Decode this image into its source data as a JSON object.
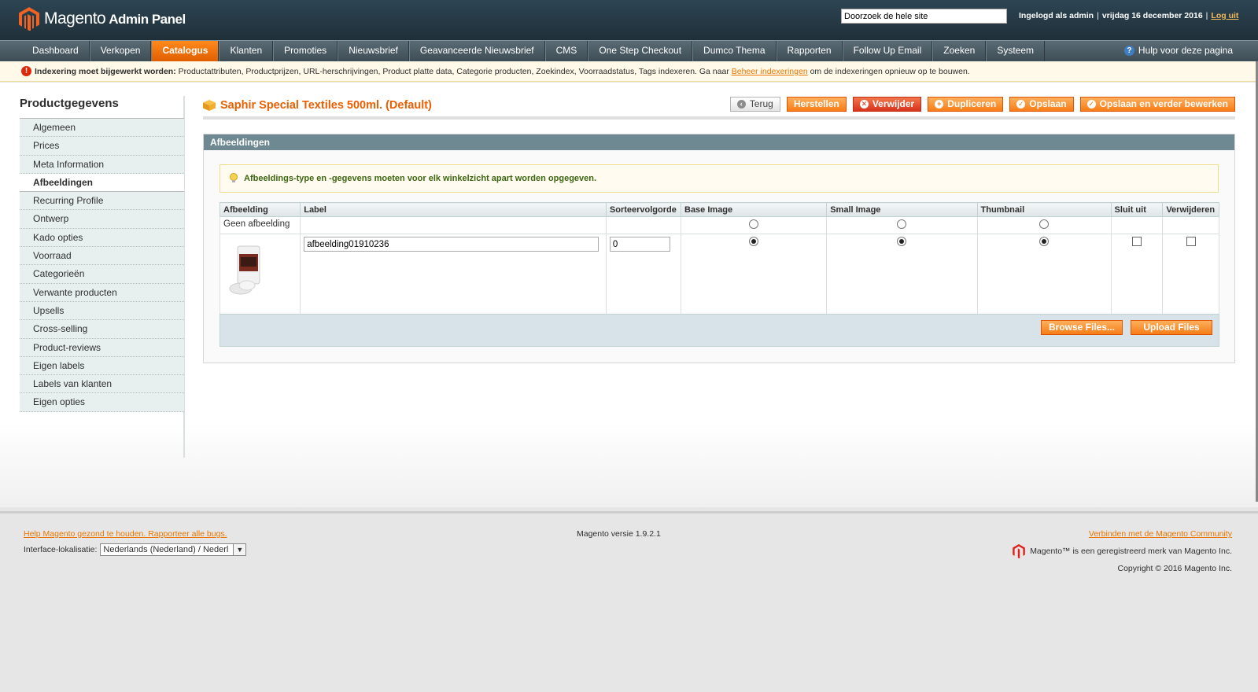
{
  "header": {
    "logo_text": "Magento",
    "logo_sub": "Admin Panel",
    "search_placeholder": "Doorzoek de hele site",
    "logged_in": "Ingelogd als admin",
    "date": "vrijdag 16 december 2016",
    "logout": "Log uit"
  },
  "nav": {
    "items": [
      "Dashboard",
      "Verkopen",
      "Catalogus",
      "Klanten",
      "Promoties",
      "Nieuwsbrief",
      "Geavanceerde Nieuwsbrief",
      "CMS",
      "One Step Checkout",
      "Dumco Thema",
      "Rapporten",
      "Follow Up Email",
      "Zoeken",
      "Systeem"
    ],
    "active": "Catalogus",
    "help": "Hulp voor deze pagina"
  },
  "notice": {
    "bold": "Indexering moet bijgewerkt worden:",
    "text": " Productattributen, Productprijzen, URL-herschrijvingen, Product platte data, Categorie producten, Zoekindex, Voorraadstatus, Tags indexeren. Ga naar ",
    "link": "Beheer indexeringen",
    "after": " om de indexeringen opnieuw op te bouwen."
  },
  "sidebar": {
    "title": "Productgegevens",
    "items": [
      "Algemeen",
      "Prices",
      "Meta Information",
      "Afbeeldingen",
      "Recurring Profile",
      "Ontwerp",
      "Kado opties",
      "Voorraad",
      "Categorieën",
      "Verwante producten",
      "Upsells",
      "Cross-selling",
      "Product-reviews",
      "Eigen labels",
      "Labels van klanten",
      "Eigen opties"
    ],
    "active": "Afbeeldingen"
  },
  "page": {
    "title": "Saphir Special Textiles 500ml. (Default)",
    "buttons": {
      "back": "Terug",
      "reset": "Herstellen",
      "delete": "Verwijder",
      "duplicate": "Dupliceren",
      "save": "Opslaan",
      "save_continue": "Opslaan en verder bewerken"
    }
  },
  "images_section": {
    "title": "Afbeeldingen",
    "tip": "Afbeeldings-type en -gegevens moeten voor elk winkelzicht apart worden opgegeven.",
    "columns": [
      "Afbeelding",
      "Label",
      "Sorteervolgorde",
      "Base Image",
      "Small Image",
      "Thumbnail",
      "Sluit uit",
      "Verwijderen"
    ],
    "no_image_label": "Geen afbeelding",
    "row": {
      "label": "afbeelding01910236",
      "sort": "0",
      "base_image": true,
      "small_image": true,
      "thumbnail": true,
      "exclude": false,
      "remove": false
    },
    "browse": "Browse Files...",
    "upload": "Upload Files"
  },
  "footer": {
    "help_link": "Help Magento gezond te houden. Rapporteer alle bugs.",
    "locale_label": "Interface-lokalisatie:",
    "locale_value": "Nederlands (Nederland) / Nederl",
    "version": "Magento versie 1.9.2.1",
    "community": "Verbinden met de Magento Community",
    "trademark": "Magento™ is een geregistreerd merk van Magento Inc.",
    "copyright": "Copyright © 2016 Magento Inc."
  },
  "colors": {
    "accent": "#eb5e00",
    "header_bg": "#2d4554",
    "section_head": "#6f8992"
  }
}
